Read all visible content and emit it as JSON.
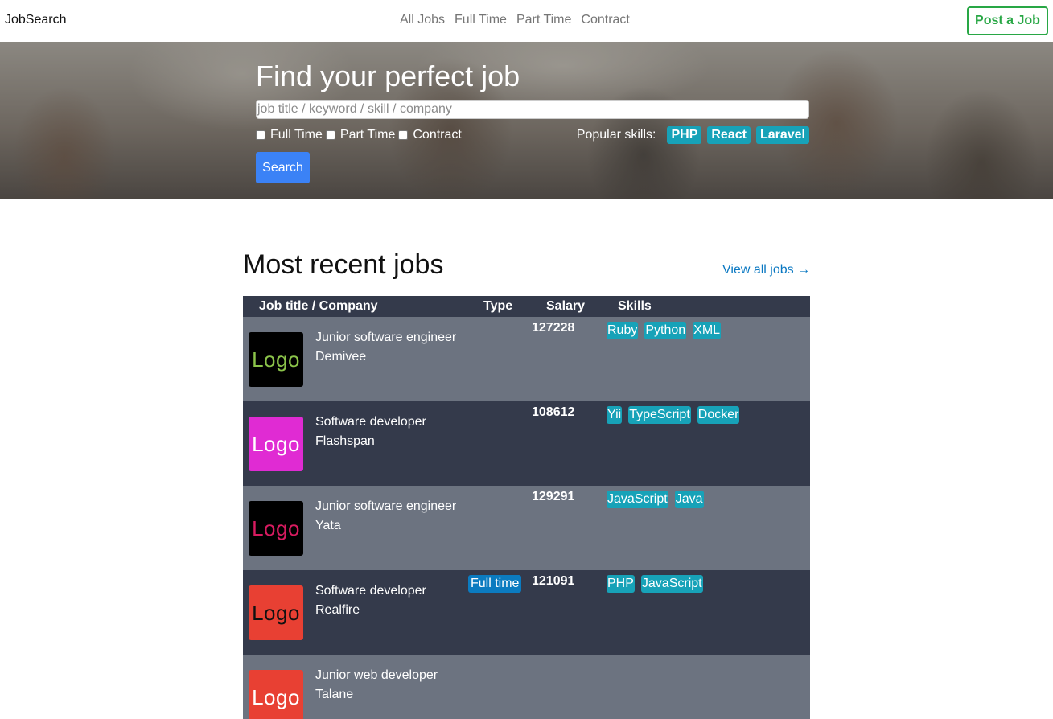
{
  "navbar": {
    "brand": "JobSearch",
    "links": [
      "All Jobs",
      "Full Time",
      "Part Time",
      "Contract"
    ],
    "post_button": "Post a Job"
  },
  "hero": {
    "title": "Find your perfect job",
    "search_placeholder": "job title / keyword / skill / company",
    "filters": [
      "Full Time",
      "Part Time",
      "Contract"
    ],
    "popular_label": "Popular skills:",
    "popular_skills": [
      "PHP",
      "React",
      "Laravel"
    ],
    "search_button": "Search"
  },
  "recent": {
    "title": "Most recent jobs",
    "view_all": "View all jobs →",
    "headers": {
      "title_company": "Job title / Company",
      "type": "Type",
      "salary": "Salary",
      "skills": "Skills"
    },
    "jobs": [
      {
        "title": "Junior software engineer",
        "company": "Demivee",
        "type": "",
        "salary": "127228",
        "skills": [
          "Ruby",
          "Python",
          "XML"
        ],
        "logo_text": "Logo",
        "logo_bg": "#000000",
        "logo_fg": "#8bc34a"
      },
      {
        "title": "Software developer",
        "company": "Flashspan",
        "type": "",
        "salary": "108612",
        "skills": [
          "Yii",
          "TypeScript",
          "Docker"
        ],
        "logo_text": "Logo",
        "logo_bg": "#e02bd3",
        "logo_fg": "#ffffff"
      },
      {
        "title": "Junior software engineer",
        "company": "Yata",
        "type": "",
        "salary": "129291",
        "skills": [
          "JavaScript",
          "Java"
        ],
        "logo_text": "Logo",
        "logo_bg": "#000000",
        "logo_fg": "#d81b60"
      },
      {
        "title": "Software developer",
        "company": "Realfire",
        "type": "Full time",
        "salary": "121091",
        "skills": [
          "PHP",
          "JavaScript"
        ],
        "logo_text": "Logo",
        "logo_bg": "#e84033",
        "logo_fg": "#111111"
      },
      {
        "title": "Junior web developer",
        "company": "Talane",
        "type": "",
        "salary": "",
        "skills": [],
        "logo_text": "Logo",
        "logo_bg": "#e84033",
        "logo_fg": "#ffffff"
      }
    ]
  },
  "colors": {
    "accent_blue": "#3b82f6",
    "success_green": "#28a745",
    "skill_teal": "#17a2b8",
    "row_light": "#6c7380",
    "row_dark": "#343a4b"
  }
}
